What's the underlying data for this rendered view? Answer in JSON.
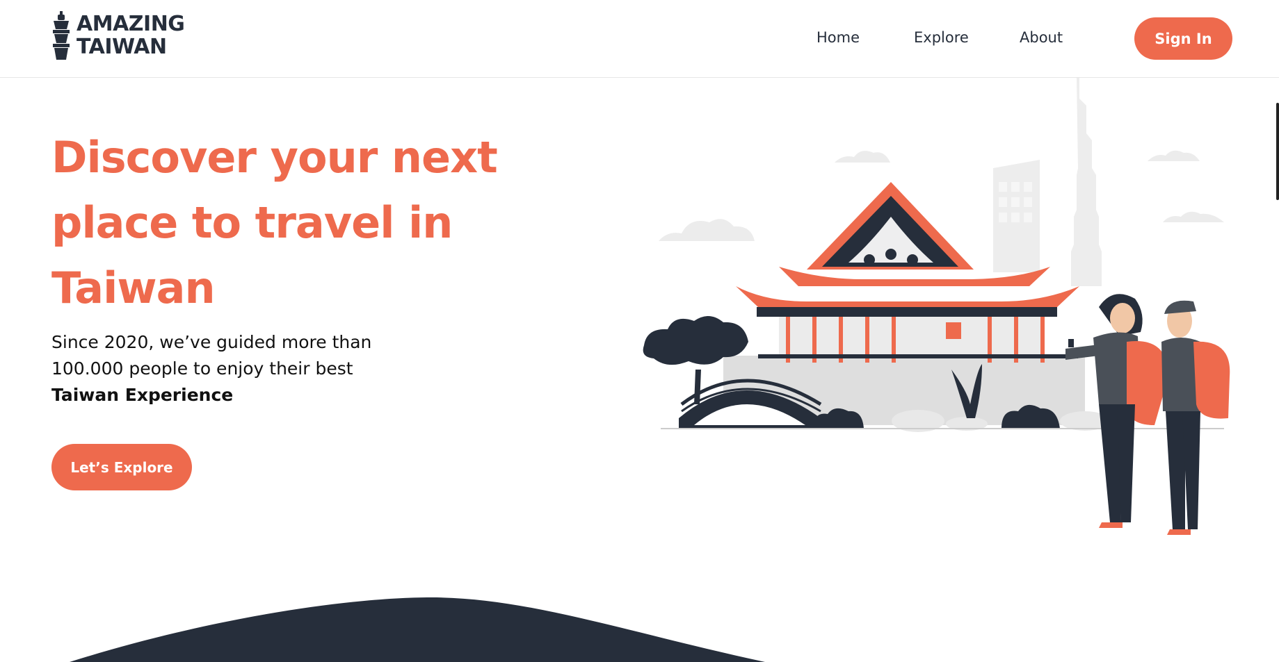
{
  "brand": {
    "line1": "AMAZING",
    "line2": "TAIWAN",
    "icon": "taipei-101-tower-icon",
    "dark_color": "#262e3b",
    "accent_color": "#ee6a4d"
  },
  "nav": {
    "links": [
      "Home",
      "Explore",
      "About"
    ],
    "signin_label": "Sign In"
  },
  "hero": {
    "title": "Discover your next place to travel in Taiwan",
    "subtitle_lead": "Since 2020, we’ve guided more than 100.000 people to enjoy their best",
    "subtitle_emphasis": "Taiwan Experience",
    "cta_label": "Let’s Explore"
  },
  "illustration": {
    "subject": "temple-with-travelers-illustration"
  }
}
